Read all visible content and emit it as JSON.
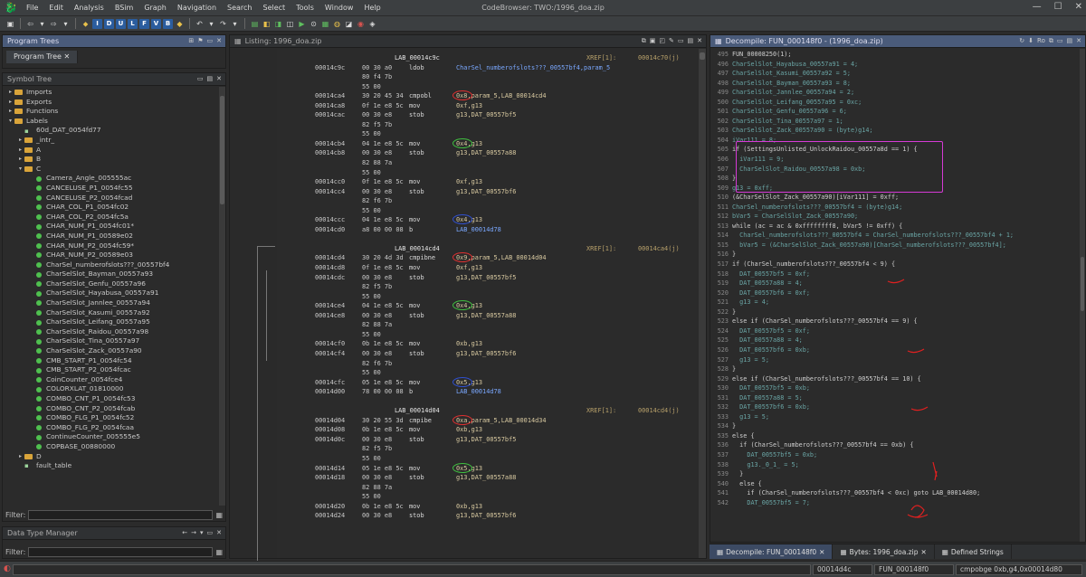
{
  "menu": [
    "File",
    "Edit",
    "Analysis",
    "BSim",
    "Graph",
    "Navigation",
    "Search",
    "Select",
    "Tools",
    "Window",
    "Help"
  ],
  "window_title": "CodeBrowser: TWO:/1996_doa.zip",
  "toolbar_letters": [
    "I",
    "D",
    "U",
    "L",
    "F",
    "V",
    "B"
  ],
  "program_trees": {
    "title": "Program Trees",
    "tab": "Program Tree"
  },
  "symbol_tree": {
    "title": "Symbol Tree",
    "items": [
      {
        "label": "Imports",
        "indent": 1,
        "kind": "folder",
        "tw": "▸"
      },
      {
        "label": "Exports",
        "indent": 1,
        "kind": "folder",
        "tw": "▸"
      },
      {
        "label": "Functions",
        "indent": 1,
        "kind": "folder",
        "tw": "▸"
      },
      {
        "label": "Labels",
        "indent": 1,
        "kind": "folder",
        "tw": "▾"
      },
      {
        "label": "60d_DAT_0054fd77",
        "indent": 2,
        "kind": "lbl",
        "tw": ""
      },
      {
        "label": "_intr_",
        "indent": 2,
        "kind": "folder",
        "tw": "▸"
      },
      {
        "label": "A",
        "indent": 2,
        "kind": "folder",
        "tw": "▸"
      },
      {
        "label": "B",
        "indent": 2,
        "kind": "folder",
        "tw": "▸"
      },
      {
        "label": "C",
        "indent": 2,
        "kind": "folder",
        "tw": "▾"
      },
      {
        "label": "Camera_Angle_005555ac",
        "indent": 3,
        "kind": "dot",
        "tw": ""
      },
      {
        "label": "CANCELUSE_P1_0054fc55",
        "indent": 3,
        "kind": "dot",
        "tw": ""
      },
      {
        "label": "CANCELUSE_P2_0054fcad",
        "indent": 3,
        "kind": "dot",
        "tw": ""
      },
      {
        "label": "CHAR_COL_P1_0054fc02",
        "indent": 3,
        "kind": "dot",
        "tw": ""
      },
      {
        "label": "CHAR_COL_P2_0054fc5a",
        "indent": 3,
        "kind": "dot",
        "tw": ""
      },
      {
        "label": "CHAR_NUM_P1_0054fc01*",
        "indent": 3,
        "kind": "dot",
        "tw": ""
      },
      {
        "label": "CHAR_NUM_P1_00589e02",
        "indent": 3,
        "kind": "dot",
        "tw": ""
      },
      {
        "label": "CHAR_NUM_P2_0054fc59*",
        "indent": 3,
        "kind": "dot",
        "tw": ""
      },
      {
        "label": "CHAR_NUM_P2_00589e03",
        "indent": 3,
        "kind": "dot",
        "tw": ""
      },
      {
        "label": "CharSel_numberofslots???_00557bf4",
        "indent": 3,
        "kind": "dot",
        "tw": ""
      },
      {
        "label": "CharSelSlot_Bayman_00557a93",
        "indent": 3,
        "kind": "dot",
        "tw": ""
      },
      {
        "label": "CharSelSlot_Genfu_00557a96",
        "indent": 3,
        "kind": "dot",
        "tw": ""
      },
      {
        "label": "CharSelSlot_Hayabusa_00557a91",
        "indent": 3,
        "kind": "dot",
        "tw": ""
      },
      {
        "label": "CharSelSlot_Jannlee_00557a94",
        "indent": 3,
        "kind": "dot",
        "tw": ""
      },
      {
        "label": "CharSelSlot_Kasumi_00557a92",
        "indent": 3,
        "kind": "dot",
        "tw": ""
      },
      {
        "label": "CharSelSlot_Leifang_00557a95",
        "indent": 3,
        "kind": "dot",
        "tw": ""
      },
      {
        "label": "CharSelSlot_Raidou_00557a98",
        "indent": 3,
        "kind": "dot",
        "tw": ""
      },
      {
        "label": "CharSelSlot_Tina_00557a97",
        "indent": 3,
        "kind": "dot",
        "tw": ""
      },
      {
        "label": "CharSelSlot_Zack_00557a90",
        "indent": 3,
        "kind": "dot",
        "tw": ""
      },
      {
        "label": "CMB_START_P1_0054fc54",
        "indent": 3,
        "kind": "dot",
        "tw": ""
      },
      {
        "label": "CMB_START_P2_0054fcac",
        "indent": 3,
        "kind": "dot",
        "tw": ""
      },
      {
        "label": "CoinCounter_0054fce4",
        "indent": 3,
        "kind": "dot",
        "tw": ""
      },
      {
        "label": "COLORXLAT_01810000",
        "indent": 3,
        "kind": "dot",
        "tw": ""
      },
      {
        "label": "COMBO_CNT_P1_0054fc53",
        "indent": 3,
        "kind": "dot",
        "tw": ""
      },
      {
        "label": "COMBO_CNT_P2_0054fcab",
        "indent": 3,
        "kind": "dot",
        "tw": ""
      },
      {
        "label": "COMBO_FLG_P1_0054fc52",
        "indent": 3,
        "kind": "dot",
        "tw": ""
      },
      {
        "label": "COMBO_FLG_P2_0054fcaa",
        "indent": 3,
        "kind": "dot",
        "tw": ""
      },
      {
        "label": "ContinueCounter_005555e5",
        "indent": 3,
        "kind": "dot",
        "tw": ""
      },
      {
        "label": "COPBASE_00880000",
        "indent": 3,
        "kind": "dot",
        "tw": ""
      },
      {
        "label": "D",
        "indent": 2,
        "kind": "folder",
        "tw": "▸"
      },
      {
        "label": "fault_table",
        "indent": 2,
        "kind": "lbl",
        "tw": ""
      }
    ],
    "filter_label": "Filter:"
  },
  "data_type_manager": {
    "title": "Data Type Manager",
    "filter_label": "Filter:"
  },
  "listing": {
    "title": "Listing:  1996_doa.zip",
    "rows": [
      {
        "addr": "",
        "hex": "",
        "mn": "",
        "op": "",
        "lab": "LAB_00014c9c",
        "xref": "XREF[1]:",
        "xoff": "00014c70(j)"
      },
      {
        "addr": "00014c9c",
        "hex": "00 30 a0",
        "mn": "ldob",
        "op": "CharSel_numberofslots???_00557bf4,param_5"
      },
      {
        "addr": "",
        "hex": "80 f4 7b",
        "mn": "",
        "op": ""
      },
      {
        "addr": "",
        "hex": "55 00",
        "mn": "",
        "op": ""
      },
      {
        "addr": "00014ca4",
        "hex": "30 20 45 34",
        "mn": "cmpobl",
        "op": "0x8,param_5,LAB_00014cd4"
      },
      {
        "addr": "00014ca8",
        "hex": "0f 1e e8 5c",
        "mn": "mov",
        "op": "0xf,g13"
      },
      {
        "addr": "00014cac",
        "hex": "00 30 e8",
        "mn": "stob",
        "op": "g13,DAT_00557bf5"
      },
      {
        "addr": "",
        "hex": "82 f5 7b",
        "mn": "",
        "op": ""
      },
      {
        "addr": "",
        "hex": "55 00",
        "mn": "",
        "op": ""
      },
      {
        "addr": "00014cb4",
        "hex": "04 1e e8 5c",
        "mn": "mov",
        "op": "0x4,g13"
      },
      {
        "addr": "00014cb8",
        "hex": "00 30 e8",
        "mn": "stob",
        "op": "g13,DAT_00557a88"
      },
      {
        "addr": "",
        "hex": "82 88 7a",
        "mn": "",
        "op": ""
      },
      {
        "addr": "",
        "hex": "55 00",
        "mn": "",
        "op": ""
      },
      {
        "addr": "00014cc0",
        "hex": "0f 1e e8 5c",
        "mn": "mov",
        "op": "0xf,g13"
      },
      {
        "addr": "00014cc4",
        "hex": "00 30 e8",
        "mn": "stob",
        "op": "g13,DAT_00557bf6"
      },
      {
        "addr": "",
        "hex": "82 f6 7b",
        "mn": "",
        "op": ""
      },
      {
        "addr": "",
        "hex": "55 00",
        "mn": "",
        "op": ""
      },
      {
        "addr": "00014ccc",
        "hex": "04 1e e8 5c",
        "mn": "mov",
        "op": "0x4,g13"
      },
      {
        "addr": "00014cd0",
        "hex": "a8 00 00 08",
        "mn": "b",
        "op": "LAB_00014d78"
      },
      {
        "addr": "",
        "hex": "",
        "mn": "",
        "op": ""
      },
      {
        "addr": "",
        "hex": "",
        "mn": "",
        "op": "",
        "lab": "LAB_00014cd4",
        "xref": "XREF[1]:",
        "xoff": "00014ca4(j)"
      },
      {
        "addr": "00014cd4",
        "hex": "30 20 4d 3d",
        "mn": "cmpibne",
        "op": "0x9,param_5,LAB_00014d04"
      },
      {
        "addr": "00014cd8",
        "hex": "0f 1e e8 5c",
        "mn": "mov",
        "op": "0xf,g13"
      },
      {
        "addr": "00014cdc",
        "hex": "00 30 e8",
        "mn": "stob",
        "op": "g13,DAT_00557bf5"
      },
      {
        "addr": "",
        "hex": "82 f5 7b",
        "mn": "",
        "op": ""
      },
      {
        "addr": "",
        "hex": "55 00",
        "mn": "",
        "op": ""
      },
      {
        "addr": "00014ce4",
        "hex": "04 1e e8 5c",
        "mn": "mov",
        "op": "0x4,g13"
      },
      {
        "addr": "00014ce8",
        "hex": "00 30 e8",
        "mn": "stob",
        "op": "g13,DAT_00557a88"
      },
      {
        "addr": "",
        "hex": "82 88 7a",
        "mn": "",
        "op": ""
      },
      {
        "addr": "",
        "hex": "55 00",
        "mn": "",
        "op": ""
      },
      {
        "addr": "00014cf0",
        "hex": "0b 1e e8 5c",
        "mn": "mov",
        "op": "0xb,g13"
      },
      {
        "addr": "00014cf4",
        "hex": "00 30 e8",
        "mn": "stob",
        "op": "g13,DAT_00557bf6"
      },
      {
        "addr": "",
        "hex": "82 f6 7b",
        "mn": "",
        "op": ""
      },
      {
        "addr": "",
        "hex": "55 00",
        "mn": "",
        "op": ""
      },
      {
        "addr": "00014cfc",
        "hex": "05 1e e8 5c",
        "mn": "mov",
        "op": "0x5,g13"
      },
      {
        "addr": "00014d00",
        "hex": "78 00 00 08",
        "mn": "b",
        "op": "LAB_00014d78"
      },
      {
        "addr": "",
        "hex": "",
        "mn": "",
        "op": ""
      },
      {
        "addr": "",
        "hex": "",
        "mn": "",
        "op": "",
        "lab": "LAB_00014d04",
        "xref": "XREF[1]:",
        "xoff": "00014cd4(j)"
      },
      {
        "addr": "00014d04",
        "hex": "30 20 55 3d",
        "mn": "cmpibe",
        "op": "0xa,param_5,LAB_00014d34"
      },
      {
        "addr": "00014d08",
        "hex": "0b 1e e8 5c",
        "mn": "mov",
        "op": "0xb,g13"
      },
      {
        "addr": "00014d0c",
        "hex": "00 30 e8",
        "mn": "stob",
        "op": "g13,DAT_00557bf5"
      },
      {
        "addr": "",
        "hex": "82 f5 7b",
        "mn": "",
        "op": ""
      },
      {
        "addr": "",
        "hex": "55 00",
        "mn": "",
        "op": ""
      },
      {
        "addr": "00014d14",
        "hex": "05 1e e8 5c",
        "mn": "mov",
        "op": "0x5,g13"
      },
      {
        "addr": "00014d18",
        "hex": "00 30 e8",
        "mn": "stob",
        "op": "g13,DAT_00557a88"
      },
      {
        "addr": "",
        "hex": "82 88 7a",
        "mn": "",
        "op": ""
      },
      {
        "addr": "",
        "hex": "55 00",
        "mn": "",
        "op": ""
      },
      {
        "addr": "00014d20",
        "hex": "0b 1e e8 5c",
        "mn": "mov",
        "op": "0xb,g13"
      },
      {
        "addr": "00014d24",
        "hex": "00 30 e8",
        "mn": "stob",
        "op": "g13,DAT_00557bf6"
      }
    ]
  },
  "decompile": {
    "title": "Decompile: FUN_000148f0 - (1996_doa.zip)",
    "lines": [
      {
        "n": "495",
        "t": "FUN_00008250(1);"
      },
      {
        "n": "496",
        "t": "CharSelSlot_Hayabusa_00557a91 = 4;"
      },
      {
        "n": "497",
        "t": "CharSelSlot_Kasumi_00557a92 = 5;"
      },
      {
        "n": "498",
        "t": "CharSelSlot_Bayman_00557a93 = 8;"
      },
      {
        "n": "499",
        "t": "CharSelSlot_Jannlee_00557a94 = 2;"
      },
      {
        "n": "500",
        "t": "CharSelSlot_Leifang_00557a95 = 0xc;"
      },
      {
        "n": "501",
        "t": "CharSelSlot_Genfu_00557a96 = 6;"
      },
      {
        "n": "502",
        "t": "CharSelSlot_Tina_00557a97 = 1;"
      },
      {
        "n": "503",
        "t": "CharSelSlot_Zack_00557a90 = (byte)g14;"
      },
      {
        "n": "504",
        "t": "iVar111 = 8;"
      },
      {
        "n": "505",
        "t": "if (SettingsUnlisted_UnlockRaidou_00557a8d == 1) {"
      },
      {
        "n": "506",
        "t": "  iVar111 = 9;"
      },
      {
        "n": "507",
        "t": "  CharSelSlot_Raidou_00557a98 = 0xb;"
      },
      {
        "n": "508",
        "t": "}"
      },
      {
        "n": "509",
        "t": "g13 = 0xff;"
      },
      {
        "n": "510",
        "t": "(&CharSelSlot_Zack_00557a90)[iVar111] = 0xff;"
      },
      {
        "n": "511",
        "t": "CharSel_numberofslots???_00557bf4 = (byte)g14;"
      },
      {
        "n": "512",
        "t": "bVar5 = CharSelSlot_Zack_00557a90;"
      },
      {
        "n": "513",
        "t": "while (ac = ac & 0xffffffff8, bVar5 != 0xff) {"
      },
      {
        "n": "514",
        "t": "  CharSel_numberofslots???_00557bf4 = CharSel_numberofslots???_00557bf4 + 1;"
      },
      {
        "n": "515",
        "t": "  bVar5 = (&CharSelSlot_Zack_00557a90)[CharSel_numberofslots???_00557bf4];"
      },
      {
        "n": "516",
        "t": "}"
      },
      {
        "n": "517",
        "t": "if (CharSel_numberofslots???_00557bf4 < 9) {"
      },
      {
        "n": "518",
        "t": "  DAT_00557bf5 = 0xf;"
      },
      {
        "n": "519",
        "t": "  DAT_00557a88 = 4;"
      },
      {
        "n": "520",
        "t": "  DAT_00557bf6 = 0xf;"
      },
      {
        "n": "521",
        "t": "  g13 = 4;"
      },
      {
        "n": "522",
        "t": "}"
      },
      {
        "n": "523",
        "t": "else if (CharSel_numberofslots???_00557bf4 == 9) {"
      },
      {
        "n": "524",
        "t": "  DAT_00557bf5 = 0xf;"
      },
      {
        "n": "525",
        "t": "  DAT_00557a88 = 4;"
      },
      {
        "n": "526",
        "t": "  DAT_00557bf6 = 0xb;"
      },
      {
        "n": "527",
        "t": "  g13 = 5;"
      },
      {
        "n": "528",
        "t": "}"
      },
      {
        "n": "529",
        "t": "else if (CharSel_numberofslots???_00557bf4 == 10) {"
      },
      {
        "n": "530",
        "t": "  DAT_00557bf5 = 0xb;"
      },
      {
        "n": "531",
        "t": "  DAT_00557a88 = 5;"
      },
      {
        "n": "532",
        "t": "  DAT_00557bf6 = 0xb;"
      },
      {
        "n": "533",
        "t": "  g13 = 5;"
      },
      {
        "n": "534",
        "t": "}"
      },
      {
        "n": "535",
        "t": "else {"
      },
      {
        "n": "536",
        "t": "  if (CharSel_numberofslots???_00557bf4 == 0xb) {"
      },
      {
        "n": "537",
        "t": "    DAT_00557bf5 = 0xb;"
      },
      {
        "n": "538",
        "t": "    g13._0_1_ = 5;"
      },
      {
        "n": "539",
        "t": "  }"
      },
      {
        "n": "540",
        "t": "  else {"
      },
      {
        "n": "541",
        "t": "    if (CharSel_numberofslots???_00557bf4 < 0xc) goto LAB_00014d80;"
      },
      {
        "n": "542",
        "t": "    DAT_00557bf5 = 7;"
      }
    ],
    "annotations": [
      "11",
      "12"
    ]
  },
  "bottom_tabs": [
    "Decompile: FUN_000148f0",
    "Bytes: 1996_doa.zip",
    "Defined Strings"
  ],
  "status": {
    "addr": "00014d4c",
    "func": "FUN_000148f0",
    "instr": "cmpobge 0xb,g4,0x00014d80"
  }
}
